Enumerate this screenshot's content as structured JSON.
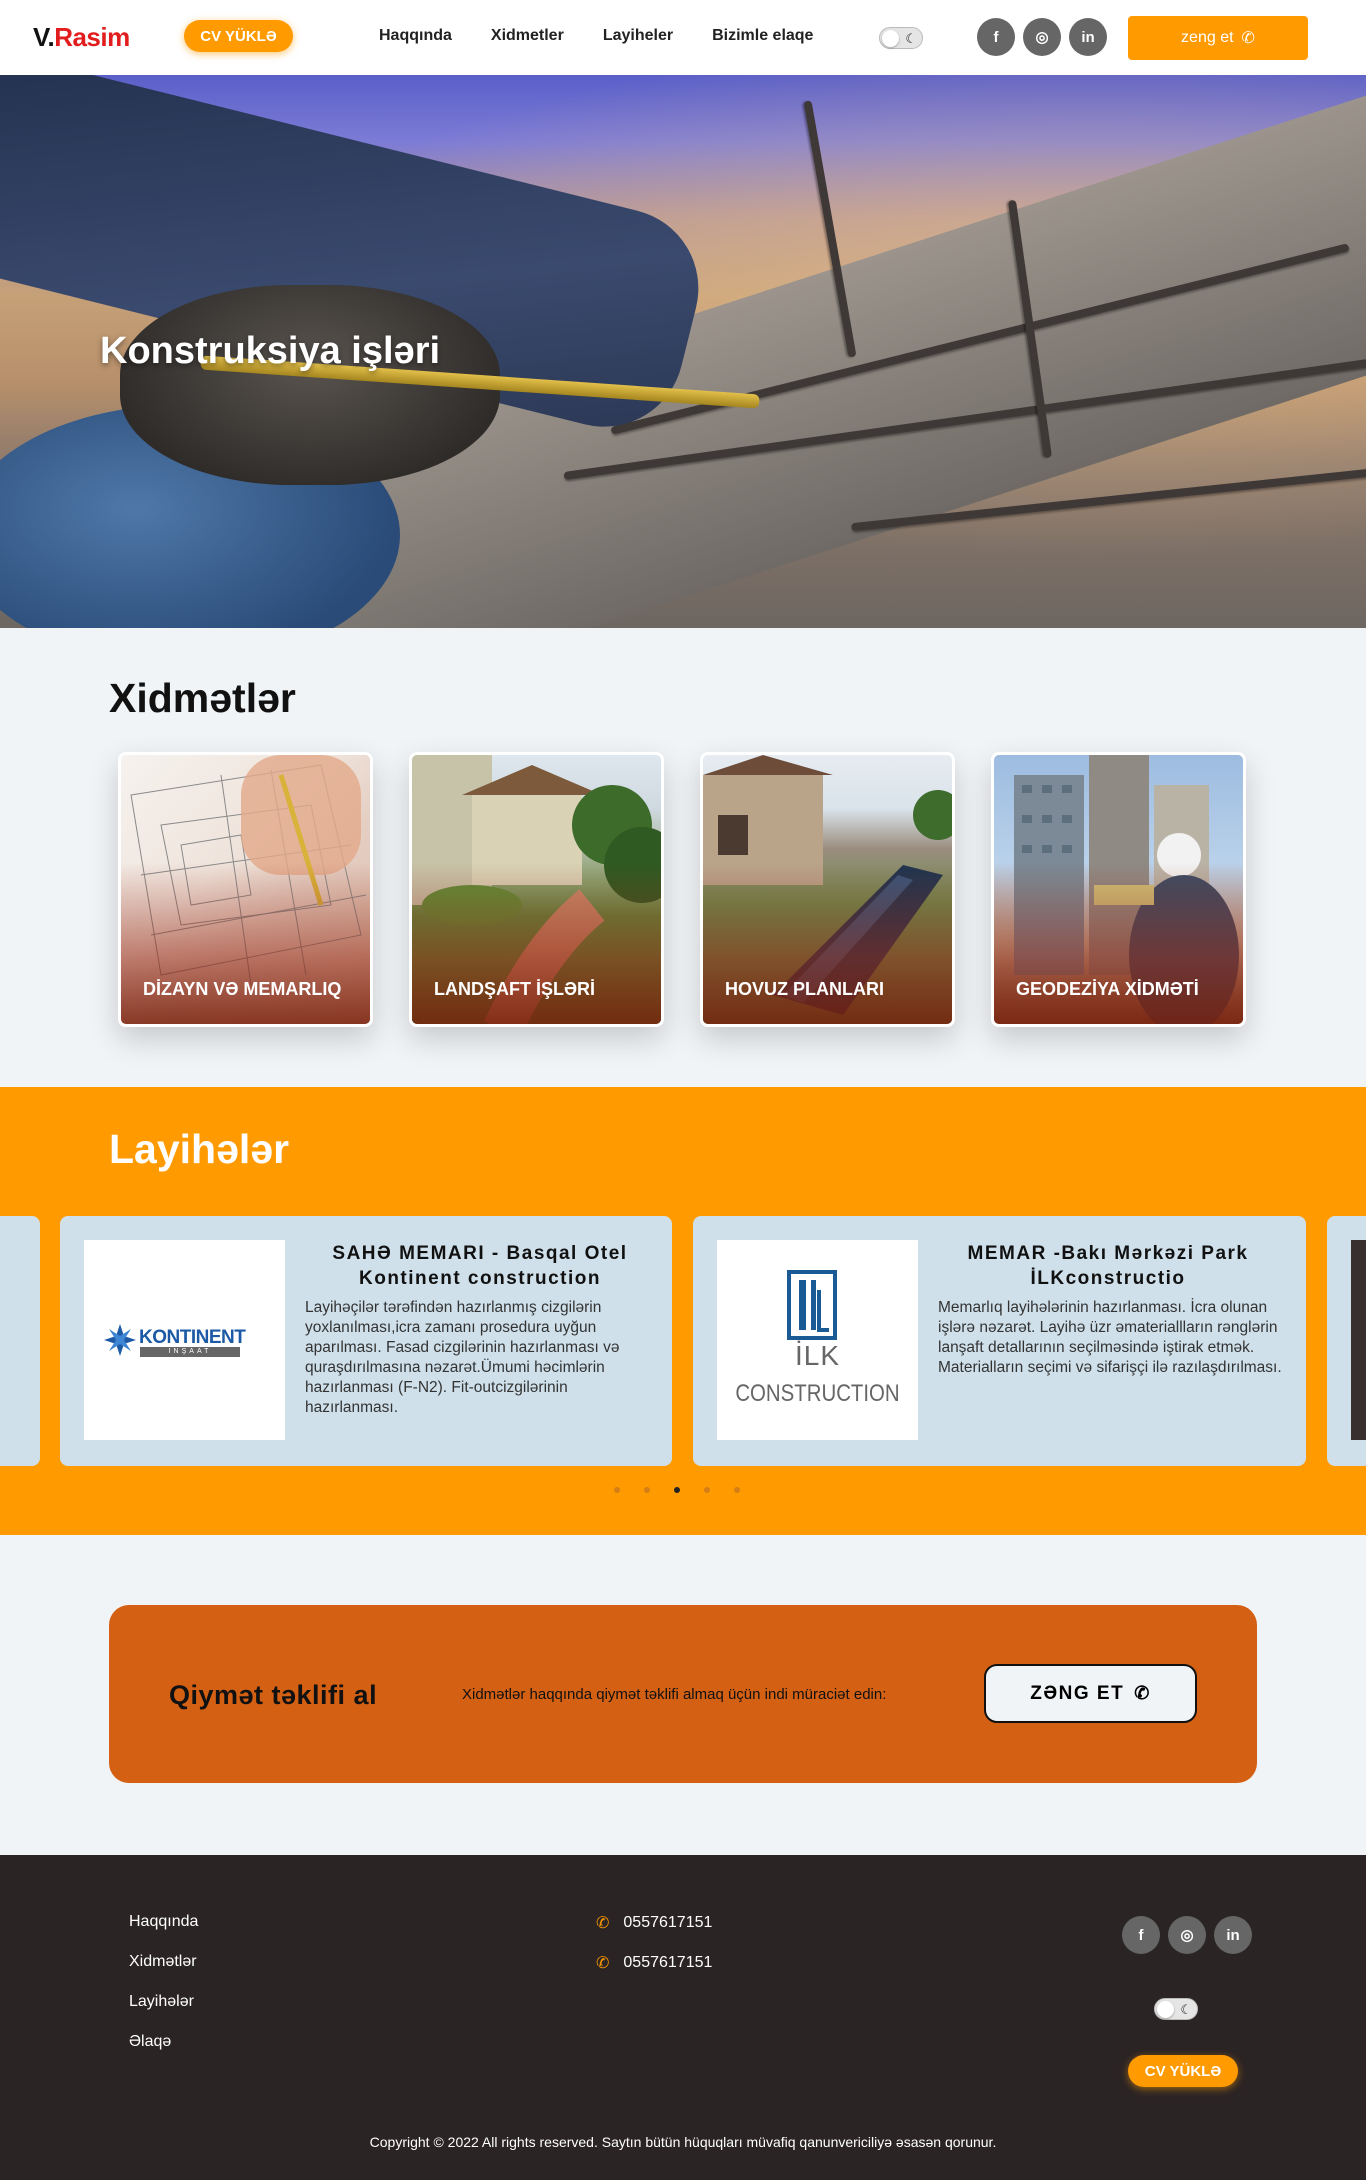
{
  "header": {
    "logo_prefix": "V.",
    "logo_name": "Rasim",
    "cv_label": "CV YÜKLƏ",
    "nav": [
      "Haqqında",
      "Xidmetler",
      "Layiheler",
      "Bizimle elaqe"
    ],
    "social": [
      "f",
      "◎",
      "in"
    ],
    "call_label": "zeng et"
  },
  "hero": {
    "title": "Konstruksiya işləri"
  },
  "services": {
    "title": "Xidmətlər",
    "cards": [
      "DİZAYN VƏ MEMARLIQ",
      "LANDŞAFT İŞLƏRİ",
      "HOVUZ PLANLARI",
      "GEODEZİYA XİDMƏTİ"
    ]
  },
  "projects": {
    "title": "Layihələr",
    "items": [
      {
        "logo_main": "KONTINENT",
        "logo_sub": "İNŞAAT",
        "title": "SAHƏ MEMARI - Basqal Otel Kontinent construction",
        "desc": "Layihəçilər tərəfindən hazırlanmış cizgilərin yoxlanılması,icra zamanı prosedura uyğun aparılması. Fasad cizgilərinin hazırlanması və quraşdırılmasına nəzarət.Ümumi həcimlərin hazırlanması (F-N2). Fit-outcizgilərinin hazırlanması."
      },
      {
        "logo_main": "İLK",
        "logo_sub": "CONSTRUCTION",
        "title": "MEMAR -Bakı Mərkəzi Park İLKconstructio",
        "desc": "Memarlıq layihələrinin hazırlanması. İcra olunan işlərə nəzarət. Layihə üzr əmateriallların rənglərin lanşaft detallarının seçilməsində iştirak etmək. Materialların seçimi və sifarişçi ilə razılaşdırılması."
      }
    ],
    "dots_count": 5,
    "active_dot": 3
  },
  "offer": {
    "title": "Qiymət təklifi al",
    "text": "Xidmətlər haqqında qiymət təklifi almaq üçün indi müraciət edin:",
    "button": "ZƏNG ET"
  },
  "footer": {
    "links": [
      "Haqqında",
      "Xidmətlər",
      "Layihələr",
      "Əlaqə"
    ],
    "phones": [
      "0557617151",
      "0557617151"
    ],
    "cv_label": "CV YÜKLƏ",
    "copyright": "Copyright © 2022 All rights reserved. Saytın bütün hüquqları müvafiq qanunvericiliyə əsasən qorunur."
  },
  "colors": {
    "accent": "#ff9a00",
    "logo_red": "#e11d1d",
    "offer_bg": "#d46014",
    "footer_bg": "#2b2424",
    "card_bg": "#cfe0ea"
  },
  "icons": [
    "phone-icon",
    "moon-icon",
    "facebook-icon",
    "instagram-icon",
    "linkedin-icon"
  ]
}
